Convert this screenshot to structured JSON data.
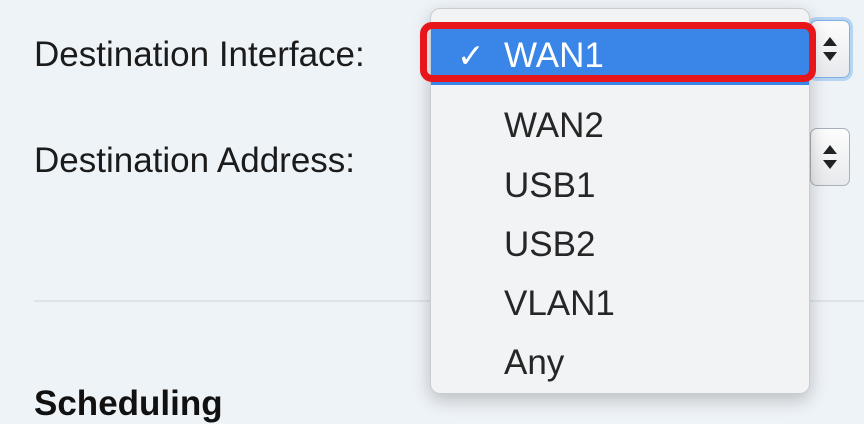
{
  "form": {
    "destination_interface_label": "Destination Interface:",
    "destination_address_label": "Destination Address:"
  },
  "section": {
    "scheduling_heading": "Scheduling"
  },
  "dropdown": {
    "check_glyph": "✓",
    "selected_value": "WAN1",
    "options": [
      "WAN1",
      "WAN2",
      "USB1",
      "USB2",
      "VLAN1",
      "Any"
    ]
  },
  "icons": {
    "select_arrows": "up-down-arrows-icon",
    "checkmark": "checkmark-icon"
  },
  "colors": {
    "selection_blue": "#3a86e8",
    "highlight_red": "#e8161b",
    "page_background": "#eef3f7"
  }
}
